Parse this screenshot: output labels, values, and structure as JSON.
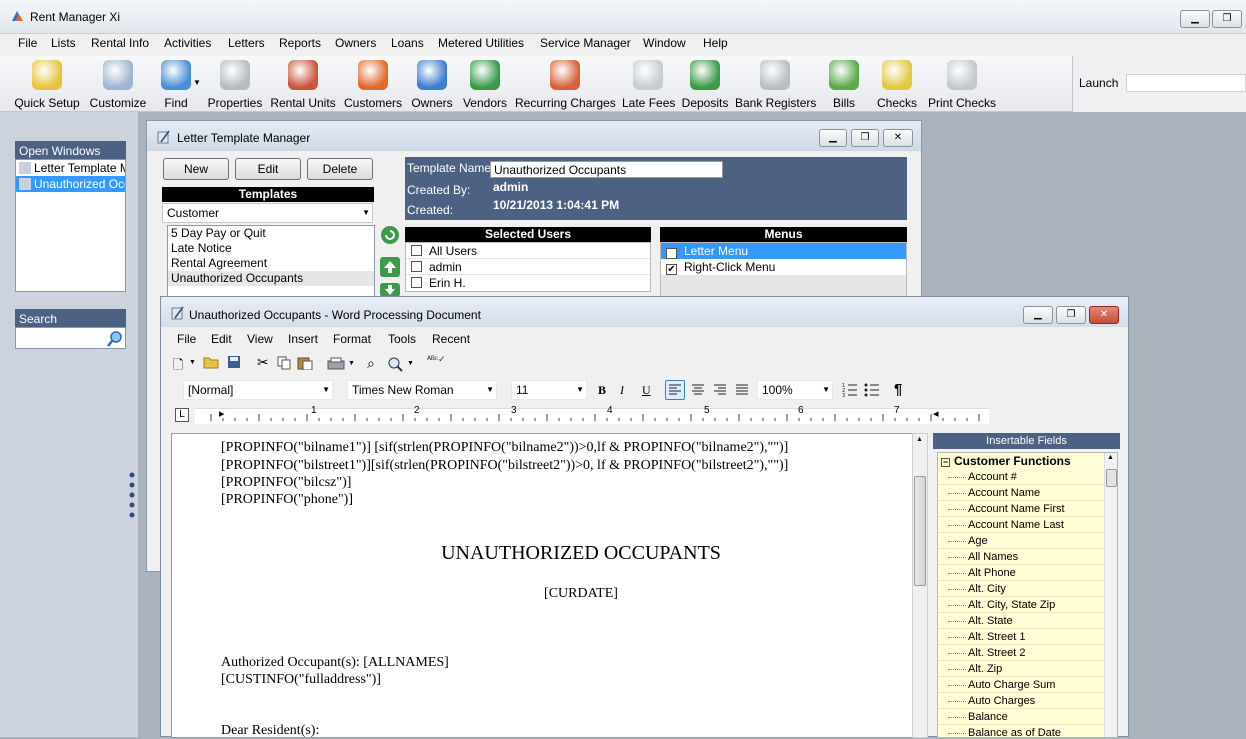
{
  "app": {
    "title": "Rent Manager Xi"
  },
  "menubar": [
    "File",
    "Lists",
    "Rental Info",
    "Activities",
    "Letters",
    "Reports",
    "Owners",
    "Loans",
    "Metered Utilities",
    "Service Manager",
    "Window",
    "Help"
  ],
  "toolbar": [
    {
      "label": "Quick Setup",
      "icon": "stopwatch-icon",
      "color": "#e7c43c"
    },
    {
      "label": "Customize",
      "icon": "customize-icon",
      "color": "#9fb6d0"
    },
    {
      "label": "Find",
      "icon": "magnifier-icon",
      "color": "#4a8ed6"
    },
    {
      "label": "Properties",
      "icon": "buildings-icon",
      "color": "#b6bcc4"
    },
    {
      "label": "Rental Units",
      "icon": "rental-unit-icon",
      "color": "#c9553c"
    },
    {
      "label": "Customers",
      "icon": "customer-person-icon",
      "color": "#e06a2c"
    },
    {
      "label": "Owners",
      "icon": "owner-person-icon",
      "color": "#3d7ed0"
    },
    {
      "label": "Vendors",
      "icon": "vendor-person-icon",
      "color": "#3a9a4a"
    },
    {
      "label": "Recurring Charges",
      "icon": "recurring-charges-icon",
      "color": "#d6623a"
    },
    {
      "label": "Late Fees",
      "icon": "clock-icon",
      "color": "#c7cdd5"
    },
    {
      "label": "Deposits",
      "icon": "deposit-icon",
      "color": "#3c9b48"
    },
    {
      "label": "Bank Registers",
      "icon": "bank-register-icon",
      "color": "#b8bec6"
    },
    {
      "label": "Bills",
      "icon": "bills-icon",
      "color": "#5ba94a"
    },
    {
      "label": "Checks",
      "icon": "checks-icon",
      "color": "#e1c940"
    },
    {
      "label": "Print Checks",
      "icon": "printer-icon",
      "color": "#c4c9cf"
    }
  ],
  "launch": {
    "label": "Launch",
    "value": ""
  },
  "sidebar": {
    "open_windows_title": "Open Windows",
    "open_windows": [
      {
        "label": "Letter Template M",
        "selected": false
      },
      {
        "label": "Unauthorized Occ",
        "selected": true
      }
    ],
    "search_title": "Search",
    "search_value": ""
  },
  "ltm": {
    "title": "Letter Template Manager",
    "buttons": {
      "new": "New",
      "edit": "Edit",
      "delete": "Delete"
    },
    "templates_header": "Templates",
    "type_select": "Customer",
    "templates": [
      "5 Day Pay or Quit",
      "Late Notice",
      "Rental Agreement",
      "Unauthorized Occupants"
    ],
    "template_name_label": "Template Name:",
    "template_name_value": "Unauthorized Occupants",
    "created_by_label": "Created By:",
    "created_by_value": "admin",
    "created_label": "Created:",
    "created_value": "10/21/2013 1:04:41 PM",
    "selected_users_header": "Selected Users",
    "users": [
      {
        "label": "All Users",
        "checked": false
      },
      {
        "label": "admin",
        "checked": false
      },
      {
        "label": "Erin H.",
        "checked": false
      }
    ],
    "menus_header": "Menus",
    "menus": [
      {
        "label": "Letter Menu",
        "checked": true,
        "selected": true
      },
      {
        "label": "Right-Click Menu",
        "checked": true,
        "selected": false
      }
    ]
  },
  "wp": {
    "title": "Unauthorized Occupants - Word Processing Document",
    "menu": [
      "File",
      "Edit",
      "View",
      "Insert",
      "Format",
      "Tools",
      "Recent"
    ],
    "style": "[Normal]",
    "font": "Times New Roman",
    "size": "11",
    "zoom": "100%",
    "ruler_numbers": [
      "1",
      "2",
      "3",
      "4",
      "5",
      "6",
      "7"
    ],
    "doc_lines": [
      "[PROPINFO(\"bilname1\")] [sif(strlen(PROPINFO(\"bilname2\"))>0,lf & PROPINFO(\"bilname2\"),\"\")]",
      "[PROPINFO(\"bilstreet1\")][sif(strlen(PROPINFO(\"bilstreet2\"))>0, lf & PROPINFO(\"bilstreet2\"),\"\")]",
      "[PROPINFO(\"bilcsz\")]",
      "[PROPINFO(\"phone\")]"
    ],
    "heading": "UNAUTHORIZED OCCUPANTS",
    "curdate": "[CURDATE]",
    "occupants_line": "Authorized Occupant(s): [ALLNAMES]",
    "address_line": "[CUSTINFO(\"fulladdress\")]",
    "greeting": "Dear Resident(s):"
  },
  "fields": {
    "header": "Insertable Fields",
    "group": "Customer Functions",
    "items": [
      "Account #",
      "Account Name",
      "Account Name First",
      "Account Name Last",
      "Age",
      "All Names",
      "Alt Phone",
      "Alt. City",
      "Alt. City, State Zip",
      "Alt. State",
      "Alt. Street 1",
      "Alt. Street 2",
      "Alt. Zip",
      "Auto Charge Sum",
      "Auto Charges",
      "Balance",
      "Balance as of Date"
    ]
  }
}
